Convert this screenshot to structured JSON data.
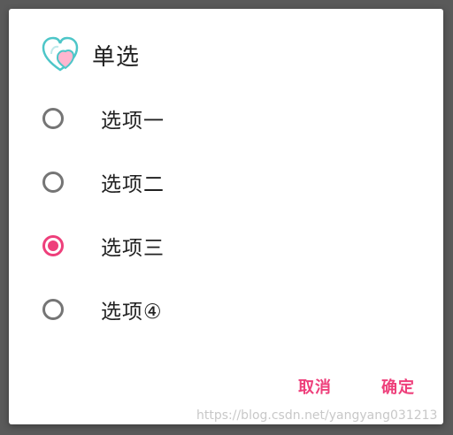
{
  "dialog": {
    "title": "单选",
    "icon": "heart-icon",
    "options": [
      {
        "label": "选项一",
        "checked": false
      },
      {
        "label": "选项二",
        "checked": false
      },
      {
        "label": "选项三",
        "checked": true
      },
      {
        "label": "选项④",
        "checked": false
      }
    ],
    "cancel_label": "取消",
    "ok_label": "确定"
  },
  "colors": {
    "accent": "#ee3f7b",
    "radio_unchecked": "#757575",
    "overlay": "#5a5a5a"
  },
  "watermark": "https://blog.csdn.net/yangyang031213"
}
